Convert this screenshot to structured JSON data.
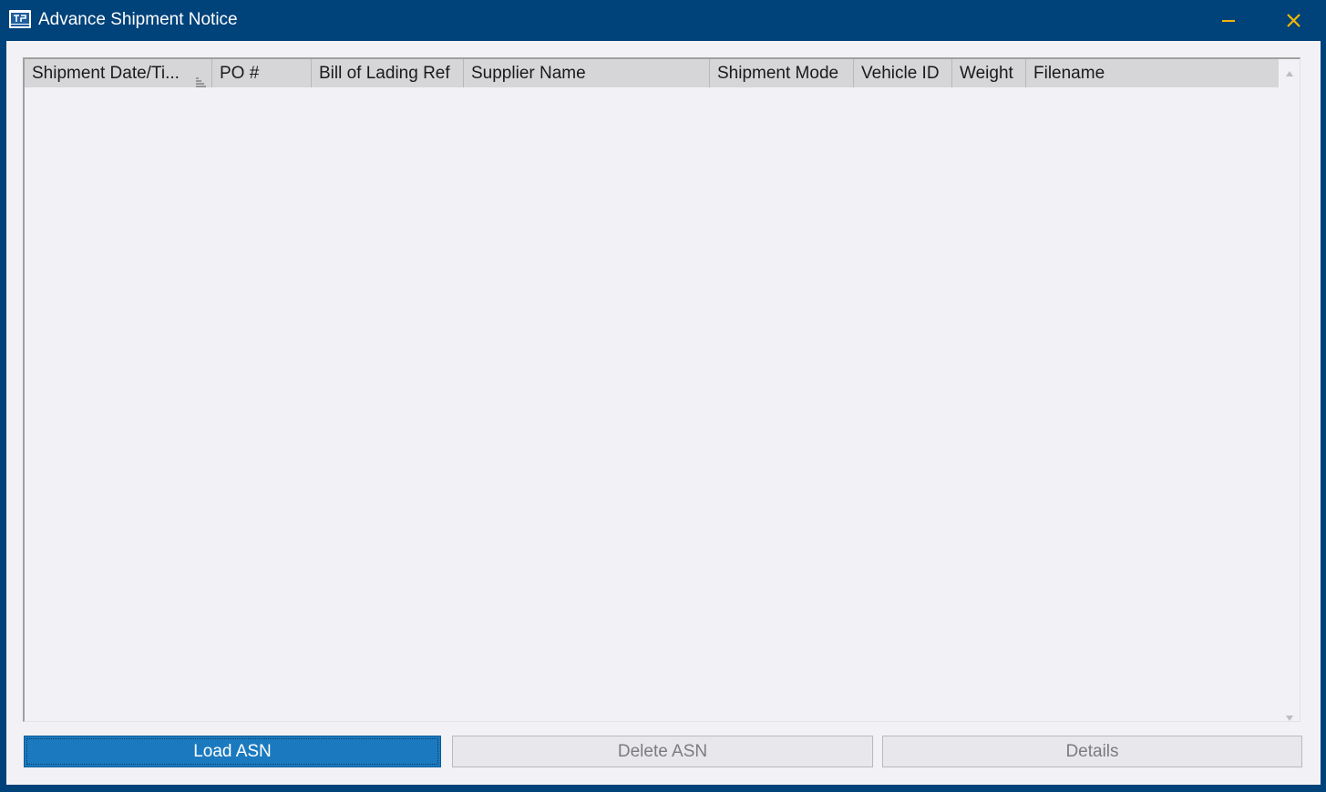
{
  "window": {
    "title": "Advance Shipment Notice",
    "icon": "app-window-icon",
    "controls": {
      "minimize_icon": "minimize-icon",
      "close_icon": "close-icon",
      "control_color": "#f2b705"
    },
    "titlebar_color": "#00427a"
  },
  "table": {
    "columns": [
      {
        "label": "Shipment Date/Ti...",
        "sorted": true
      },
      {
        "label": "PO #"
      },
      {
        "label": "Bill of Lading Ref"
      },
      {
        "label": "Supplier Name"
      },
      {
        "label": "Shipment Mode"
      },
      {
        "label": "Vehicle ID"
      },
      {
        "label": "Weight"
      },
      {
        "label": "Filename"
      }
    ],
    "rows": []
  },
  "buttons": {
    "load": {
      "label": "Load ASN",
      "enabled": true
    },
    "delete": {
      "label": "Delete ASN",
      "enabled": false
    },
    "details": {
      "label": "Details",
      "enabled": false
    }
  },
  "colors": {
    "accent": "#1b7abf",
    "header_bg": "#d6d6d9",
    "body_bg": "#f2f2f6"
  }
}
